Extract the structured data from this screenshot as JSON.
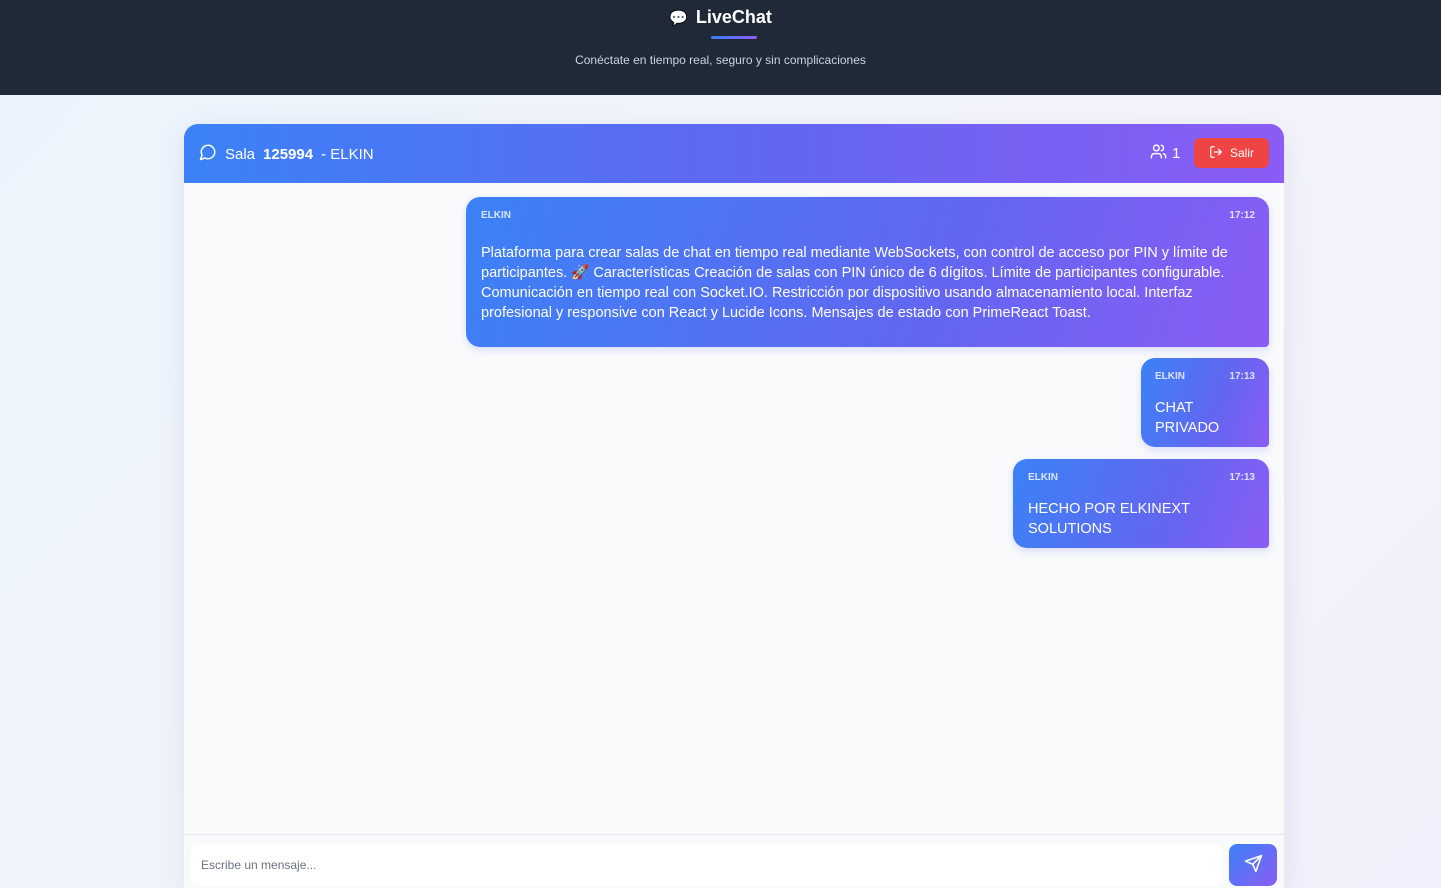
{
  "app": {
    "name": "LiveChat",
    "tagline": "Conéctate en tiempo real, seguro y sin complicaciones",
    "logo_icon": "speech-bubble-icon"
  },
  "room": {
    "prefix": "Sala",
    "pin": "125994",
    "user_suffix": "- ELKIN",
    "participants": "1",
    "exit_label": "Salir"
  },
  "messages": [
    {
      "author": "ELKIN",
      "time": "17:12",
      "text": "Plataforma para crear salas de chat en tiempo real mediante WebSockets, con control de acceso por PIN y límite de participantes. 🚀 Características Creación de salas con PIN único de 6 dígitos. Límite de participantes configurable. Comunicación en tiempo real con Socket.IO. Restricción por dispositivo usando almacenamiento local. Interfaz profesional y responsive con React y Lucide Icons. Mensajes de estado con PrimeReact Toast."
    },
    {
      "author": "ELKIN",
      "time": "17:13",
      "text": "CHAT PRIVADO"
    },
    {
      "author": "ELKIN",
      "time": "17:13",
      "text": "HECHO POR ELKINEXT SOLUTIONS"
    }
  ],
  "composer": {
    "placeholder": "Escribe un mensaje...",
    "value": ""
  },
  "colors": {
    "topbar": "#1f2937",
    "accent_start": "#3b82f6",
    "accent_end": "#8b5cf6",
    "exit": "#ef4444"
  }
}
